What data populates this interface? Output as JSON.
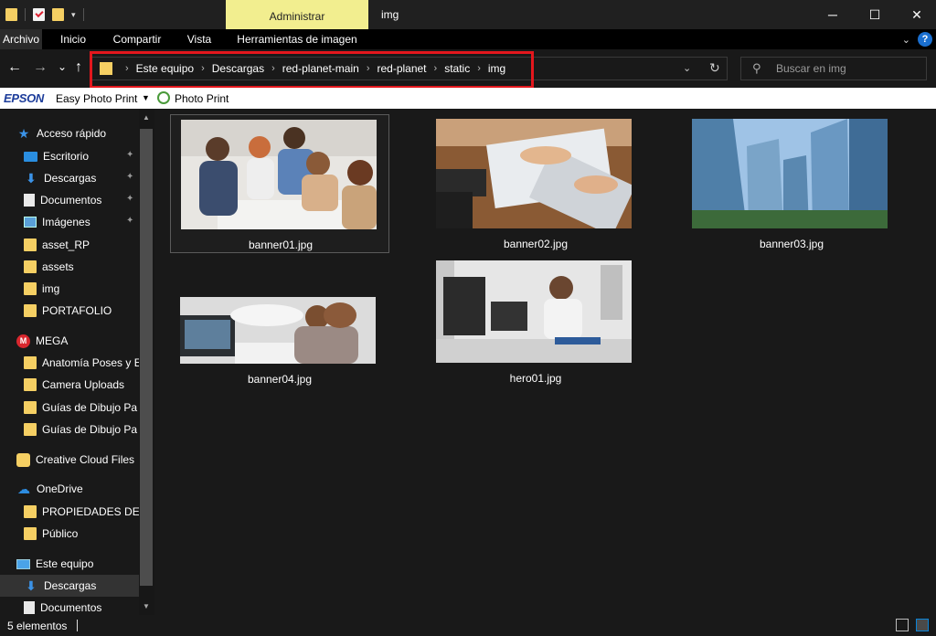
{
  "window": {
    "title": "img",
    "context_tab": "Administrar",
    "minimize": "─",
    "maximize": "☐",
    "close": "✕"
  },
  "ribbon": {
    "tabs": [
      "Archivo",
      "Inicio",
      "Compartir",
      "Vista",
      "Herramientas de imagen"
    ],
    "help": "?"
  },
  "nav": {
    "back": "←",
    "forward": "→",
    "recent": "⌄",
    "up": "↑"
  },
  "address": {
    "crumbs": [
      "Este equipo",
      "Descargas",
      "red-planet-main",
      "red-planet",
      "static",
      "img"
    ],
    "chevron": "›"
  },
  "search": {
    "placeholder": "Buscar en img"
  },
  "epson": {
    "brand": "EPSON",
    "easy_photo_print": "Easy Photo Print",
    "photo_print": "Photo Print"
  },
  "sidebar": {
    "items": [
      {
        "label": "Acceso rápido",
        "icon": "star-icon"
      },
      {
        "label": "Escritorio",
        "icon": "desktop-icon",
        "pinned": true
      },
      {
        "label": "Descargas",
        "icon": "download-icon",
        "pinned": true
      },
      {
        "label": "Documentos",
        "icon": "document-icon",
        "pinned": true
      },
      {
        "label": "Imágenes",
        "icon": "pictures-icon",
        "pinned": true
      },
      {
        "label": "asset_RP",
        "icon": "folder-icon"
      },
      {
        "label": "assets",
        "icon": "folder-icon"
      },
      {
        "label": "img",
        "icon": "folder-icon"
      },
      {
        "label": "PORTAFOLIO",
        "icon": "folder-icon"
      },
      {
        "label": "MEGA",
        "icon": "mega-icon"
      },
      {
        "label": "Anatomía Poses y E",
        "icon": "folder-icon"
      },
      {
        "label": "Camera Uploads",
        "icon": "folder-icon"
      },
      {
        "label": "Guías de Dibujo Pa",
        "icon": "folder-icon"
      },
      {
        "label": "Guías de Dibujo Pa",
        "icon": "folder-icon"
      },
      {
        "label": "Creative Cloud Files",
        "icon": "creative-cloud-icon"
      },
      {
        "label": "OneDrive",
        "icon": "cloud-icon"
      },
      {
        "label": "PROPIEDADES DE L",
        "icon": "folder-icon"
      },
      {
        "label": "Público",
        "icon": "folder-icon"
      },
      {
        "label": "Este equipo",
        "icon": "computer-icon"
      },
      {
        "label": "Descargas",
        "icon": "download-icon",
        "selected": true
      },
      {
        "label": "Documentos",
        "icon": "document-icon"
      }
    ],
    "pin_glyph": "📌"
  },
  "files": [
    {
      "name": "banner01.jpg",
      "selected": true
    },
    {
      "name": "banner02.jpg"
    },
    {
      "name": "banner03.jpg"
    },
    {
      "name": "banner04.jpg"
    },
    {
      "name": "hero01.jpg"
    }
  ],
  "status": {
    "count": "5 elementos"
  }
}
